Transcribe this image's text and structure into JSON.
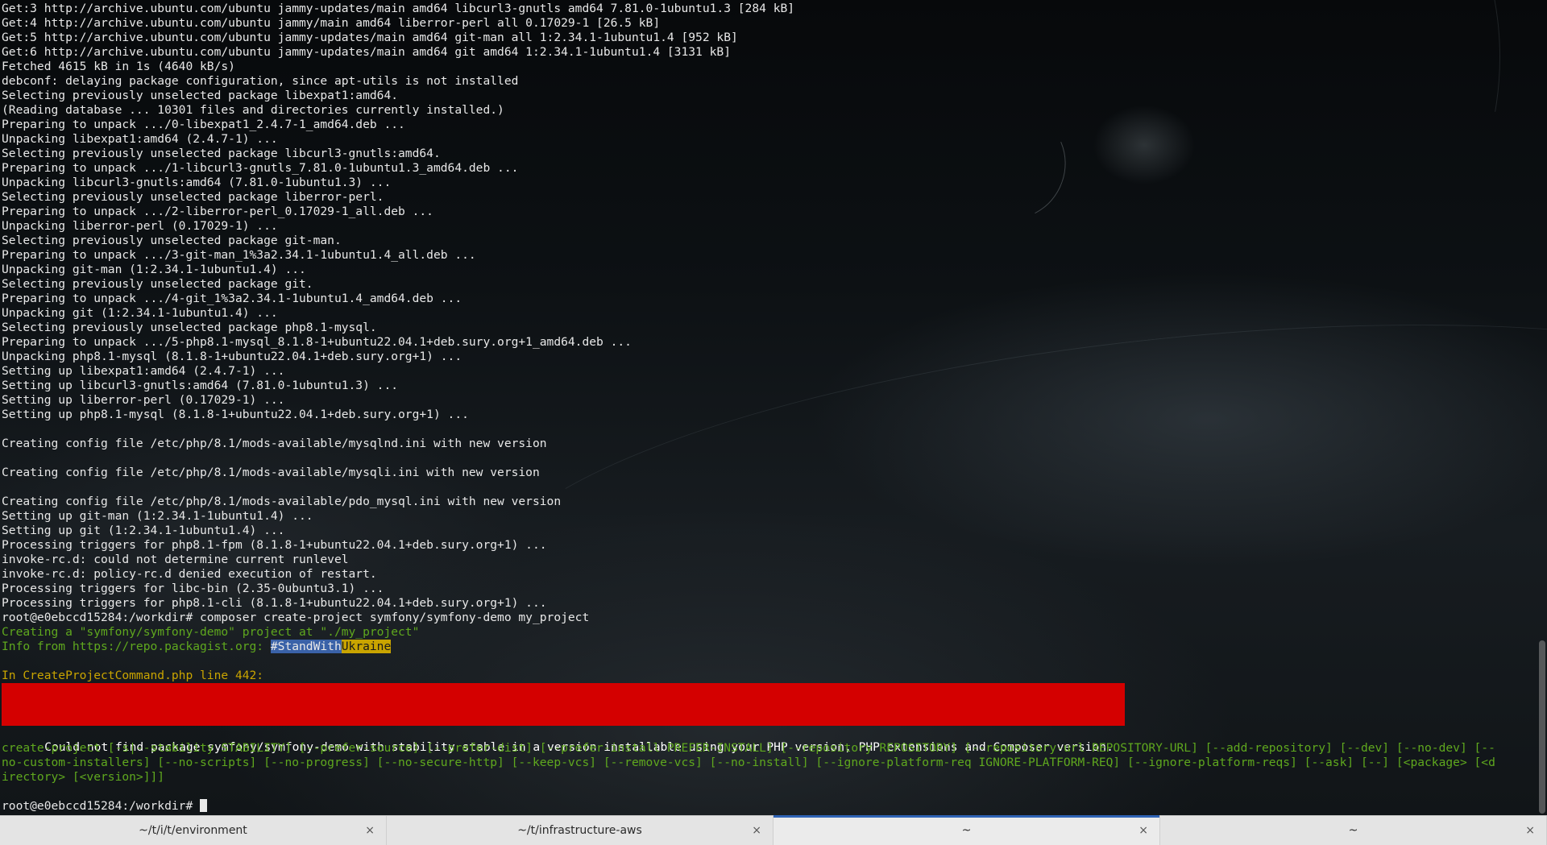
{
  "terminal": {
    "lines": [
      {
        "text": "Get:3 http://archive.ubuntu.com/ubuntu jammy-updates/main amd64 libcurl3-gnutls amd64 7.81.0-1ubuntu1.3 [284 kB]"
      },
      {
        "text": "Get:4 http://archive.ubuntu.com/ubuntu jammy/main amd64 liberror-perl all 0.17029-1 [26.5 kB]"
      },
      {
        "text": "Get:5 http://archive.ubuntu.com/ubuntu jammy-updates/main amd64 git-man all 1:2.34.1-1ubuntu1.4 [952 kB]"
      },
      {
        "text": "Get:6 http://archive.ubuntu.com/ubuntu jammy-updates/main amd64 git amd64 1:2.34.1-1ubuntu1.4 [3131 kB]"
      },
      {
        "text": "Fetched 4615 kB in 1s (4640 kB/s)"
      },
      {
        "text": "debconf: delaying package configuration, since apt-utils is not installed"
      },
      {
        "text": "Selecting previously unselected package libexpat1:amd64."
      },
      {
        "text": "(Reading database ... 10301 files and directories currently installed.)"
      },
      {
        "text": "Preparing to unpack .../0-libexpat1_2.4.7-1_amd64.deb ..."
      },
      {
        "text": "Unpacking libexpat1:amd64 (2.4.7-1) ..."
      },
      {
        "text": "Selecting previously unselected package libcurl3-gnutls:amd64."
      },
      {
        "text": "Preparing to unpack .../1-libcurl3-gnutls_7.81.0-1ubuntu1.3_amd64.deb ..."
      },
      {
        "text": "Unpacking libcurl3-gnutls:amd64 (7.81.0-1ubuntu1.3) ..."
      },
      {
        "text": "Selecting previously unselected package liberror-perl."
      },
      {
        "text": "Preparing to unpack .../2-liberror-perl_0.17029-1_all.deb ..."
      },
      {
        "text": "Unpacking liberror-perl (0.17029-1) ..."
      },
      {
        "text": "Selecting previously unselected package git-man."
      },
      {
        "text": "Preparing to unpack .../3-git-man_1%3a2.34.1-1ubuntu1.4_all.deb ..."
      },
      {
        "text": "Unpacking git-man (1:2.34.1-1ubuntu1.4) ..."
      },
      {
        "text": "Selecting previously unselected package git."
      },
      {
        "text": "Preparing to unpack .../4-git_1%3a2.34.1-1ubuntu1.4_amd64.deb ..."
      },
      {
        "text": "Unpacking git (1:2.34.1-1ubuntu1.4) ..."
      },
      {
        "text": "Selecting previously unselected package php8.1-mysql."
      },
      {
        "text": "Preparing to unpack .../5-php8.1-mysql_8.1.8-1+ubuntu22.04.1+deb.sury.org+1_amd64.deb ..."
      },
      {
        "text": "Unpacking php8.1-mysql (8.1.8-1+ubuntu22.04.1+deb.sury.org+1) ..."
      },
      {
        "text": "Setting up libexpat1:amd64 (2.4.7-1) ..."
      },
      {
        "text": "Setting up libcurl3-gnutls:amd64 (7.81.0-1ubuntu1.3) ..."
      },
      {
        "text": "Setting up liberror-perl (0.17029-1) ..."
      },
      {
        "text": "Setting up php8.1-mysql (8.1.8-1+ubuntu22.04.1+deb.sury.org+1) ..."
      },
      {
        "text": ""
      },
      {
        "text": "Creating config file /etc/php/8.1/mods-available/mysqlnd.ini with new version"
      },
      {
        "text": ""
      },
      {
        "text": "Creating config file /etc/php/8.1/mods-available/mysqli.ini with new version"
      },
      {
        "text": ""
      },
      {
        "text": "Creating config file /etc/php/8.1/mods-available/pdo_mysql.ini with new version"
      },
      {
        "text": "Setting up git-man (1:2.34.1-1ubuntu1.4) ..."
      },
      {
        "text": "Setting up git (1:2.34.1-1ubuntu1.4) ..."
      },
      {
        "text": "Processing triggers for php8.1-fpm (8.1.8-1+ubuntu22.04.1+deb.sury.org+1) ..."
      },
      {
        "text": "invoke-rc.d: could not determine current runlevel"
      },
      {
        "text": "invoke-rc.d: policy-rc.d denied execution of restart."
      },
      {
        "text": "Processing triggers for libc-bin (2.35-0ubuntu3.1) ..."
      },
      {
        "text": "Processing triggers for php8.1-cli (8.1.8-1+ubuntu22.04.1+deb.sury.org+1) ..."
      },
      {
        "text": "root@e0ebccd15284:/workdir# composer create-project symfony/symfony-demo my_project"
      },
      {
        "text": "Creating a \"symfony/symfony-demo\" project at \"./my_project\"",
        "color": "green"
      }
    ],
    "info_line": {
      "prefix": "Info from https://repo.packagist.org: ",
      "tag_part1": "#StandWith",
      "tag_part2": "Ukraine"
    },
    "blank_after_info": "",
    "error_location": "In CreateProjectCommand.php line 442:",
    "error_message": "Could not find package symfony/symfony-demo with stability stable in a version installable using your PHP version, PHP extensions and Composer version.",
    "usage_lines": [
      "create-project [-s|--stability STABILITY] [--prefer-source] [--prefer-dist] [--prefer-install PREFER-INSTALL] [--repository REPOSITORY] [--repository-url REPOSITORY-URL] [--add-repository] [--dev] [--no-dev] [--",
      "no-custom-installers] [--no-scripts] [--no-progress] [--no-secure-http] [--keep-vcs] [--remove-vcs] [--no-install] [--ignore-platform-req IGNORE-PLATFORM-REQ] [--ignore-platform-reqs] [--ask] [--] [<package> [<d",
      "irectory> [<version>]]]"
    ],
    "prompt": "root@e0ebccd15284:/workdir# "
  },
  "tabs": [
    {
      "label": "~/t/i/t/environment",
      "active": false,
      "close": "×"
    },
    {
      "label": "~/t/infrastructure-aws",
      "active": false,
      "close": "×"
    },
    {
      "label": "~",
      "active": true,
      "close": "×"
    },
    {
      "label": "~",
      "active": false,
      "close": "×"
    }
  ],
  "colors": {
    "output_green": "#5fa81e",
    "output_yellow": "#c9a400",
    "error_bg": "#d40000",
    "active_tab_accent": "#2f63b5"
  }
}
